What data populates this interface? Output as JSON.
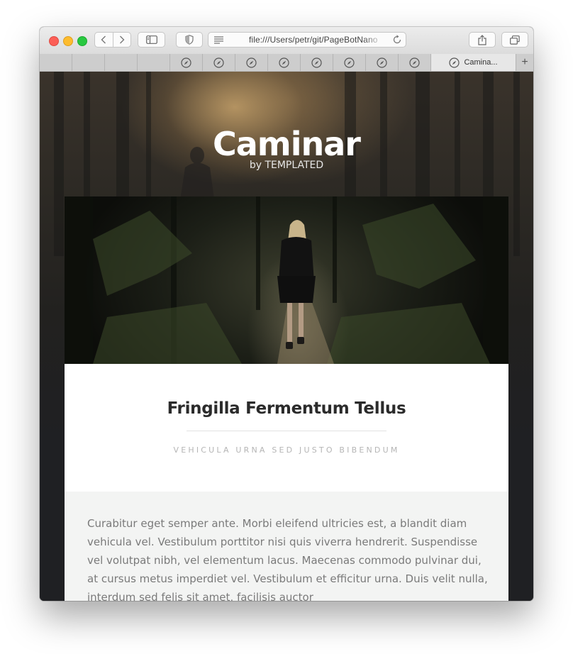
{
  "browser": {
    "url": "file:///Users/petr/git/PageBotNano",
    "active_tab_title": "Camina...",
    "new_tab_label": "+",
    "tabs_blank": 4,
    "tabs_compass": 8
  },
  "hero": {
    "title": "Caminar",
    "subtitle": "by TEMPLATED"
  },
  "article": {
    "heading": "Fringilla Fermentum Tellus",
    "subheading": "VEHICULA URNA SED JUSTO BIBENDUM",
    "body": "Curabitur eget semper ante. Morbi eleifend ultricies est, a blandit diam vehicula vel. Vestibulum porttitor nisi quis viverra hendrerit. Suspendisse vel volutpat nibh, vel elementum lacus. Maecenas commodo pulvinar dui, at cursus metus imperdiet vel. Vestibulum et efficitur urna. Duis velit nulla, interdum sed felis sit amet, facilisis auctor"
  },
  "colors": {
    "close": "#fc5f57",
    "minimize": "#fdbc2e",
    "zoom": "#28c840",
    "page_bg": "#1f2023",
    "heading_text": "#2b2b2b",
    "subheading_text": "#b5b5b5",
    "body_text": "#7a7a7a",
    "gray_panel": "#f3f4f3"
  },
  "icons": {
    "back": "chevron-left-icon",
    "forward": "chevron-right-icon",
    "sidebar": "sidebar-icon",
    "privacy": "shield-icon",
    "reader": "reader-lines-icon",
    "reload": "reload-icon",
    "share": "share-icon",
    "tabs": "tabs-overview-icon",
    "tab_favicon": "compass-icon"
  }
}
